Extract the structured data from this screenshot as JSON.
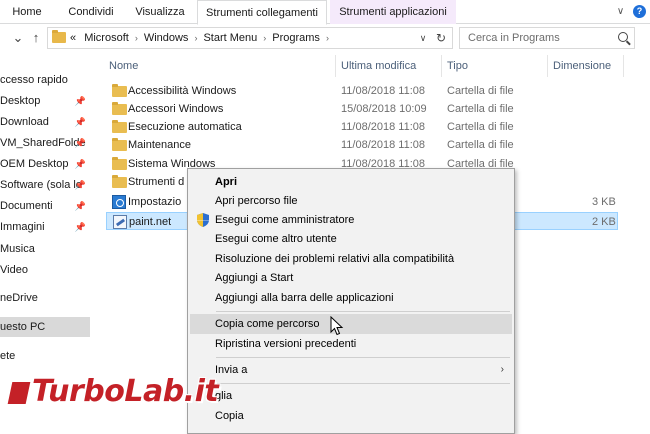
{
  "ribbon": {
    "tabs": [
      {
        "label": "Home"
      },
      {
        "label": "Condividi"
      },
      {
        "label": "Visualizza"
      },
      {
        "label": "Strumenti collegamenti"
      },
      {
        "label": "Strumenti applicazioni"
      }
    ],
    "collapse_glyph": "∨"
  },
  "address": {
    "prefix": "«",
    "crumbs": [
      "Microsoft",
      "Windows",
      "Start Menu",
      "Programs"
    ],
    "search_placeholder": "Cerca in Programs"
  },
  "navpane": {
    "items": [
      {
        "label": "ccesso rapido",
        "pinned": false
      },
      {
        "label": "Desktop",
        "pinned": true
      },
      {
        "label": "Download",
        "pinned": true
      },
      {
        "label": "VM_SharedFolde",
        "pinned": true
      },
      {
        "label": "OEM Desktop",
        "pinned": true
      },
      {
        "label": "Software (sola le",
        "pinned": true
      },
      {
        "label": "Documenti",
        "pinned": true
      },
      {
        "label": "Immagini",
        "pinned": true
      },
      {
        "label": "Musica",
        "pinned": false
      },
      {
        "label": "Video",
        "pinned": false
      },
      {
        "label": "neDrive",
        "pinned": false
      },
      {
        "label": "uesto PC",
        "pinned": false
      },
      {
        "label": "ete",
        "pinned": false
      }
    ]
  },
  "filelist": {
    "columns": [
      "Nome",
      "Ultima modifica",
      "Tipo",
      "Dimensione"
    ],
    "rows": [
      {
        "name": "Accessibilità Windows",
        "date": "11/08/2018 11:08",
        "type": "Cartella di file",
        "size": "",
        "icon": "folder-icon"
      },
      {
        "name": "Accessori Windows",
        "date": "15/08/2018 10:09",
        "type": "Cartella di file",
        "size": "",
        "icon": "folder-icon"
      },
      {
        "name": "Esecuzione automatica",
        "date": "11/08/2018 11:08",
        "type": "Cartella di file",
        "size": "",
        "icon": "folder-icon"
      },
      {
        "name": "Maintenance",
        "date": "11/08/2018 11:08",
        "type": "Cartella di file",
        "size": "",
        "icon": "folder-icon"
      },
      {
        "name": "Sistema Windows",
        "date": "11/08/2018 11:08",
        "type": "Cartella di file",
        "size": "",
        "icon": "folder-icon"
      },
      {
        "name": "Strumenti d",
        "date": "",
        "type": "",
        "size": "",
        "icon": "folder-icon"
      },
      {
        "name": "Impostazio",
        "date": "",
        "type": "",
        "size": "3 KB",
        "icon": "shortcut-icon"
      },
      {
        "name": "paint.net",
        "date": "",
        "type": "",
        "size": "2 KB",
        "icon": "paint-icon"
      }
    ]
  },
  "context_menu": {
    "items": [
      {
        "label": "Apri",
        "bold": true
      },
      {
        "label": "Apri percorso file"
      },
      {
        "label": "Esegui come amministratore",
        "icon": "shield-icon"
      },
      {
        "label": "Esegui come altro utente"
      },
      {
        "label": "Risoluzione dei problemi relativi alla compatibilità"
      },
      {
        "label": "Aggiungi a Start"
      },
      {
        "label": "Aggiungi alla barra delle applicazioni"
      },
      {
        "label": "Copia come percorso",
        "hover": true
      },
      {
        "label": "Ripristina versioni precedenti"
      },
      {
        "label": "Invia a",
        "submenu": true
      },
      {
        "label": "glia"
      },
      {
        "label": "Copia"
      }
    ],
    "submenu_arrow": "›"
  },
  "watermark": {
    "text": "TurboLab.it"
  },
  "colors": {
    "selection": "#cce8ff",
    "context_tab_links": "#fdf6d6",
    "context_tab_apps": "#f5eafb",
    "brand_red": "#c42127",
    "folder": "#e9bd51"
  }
}
